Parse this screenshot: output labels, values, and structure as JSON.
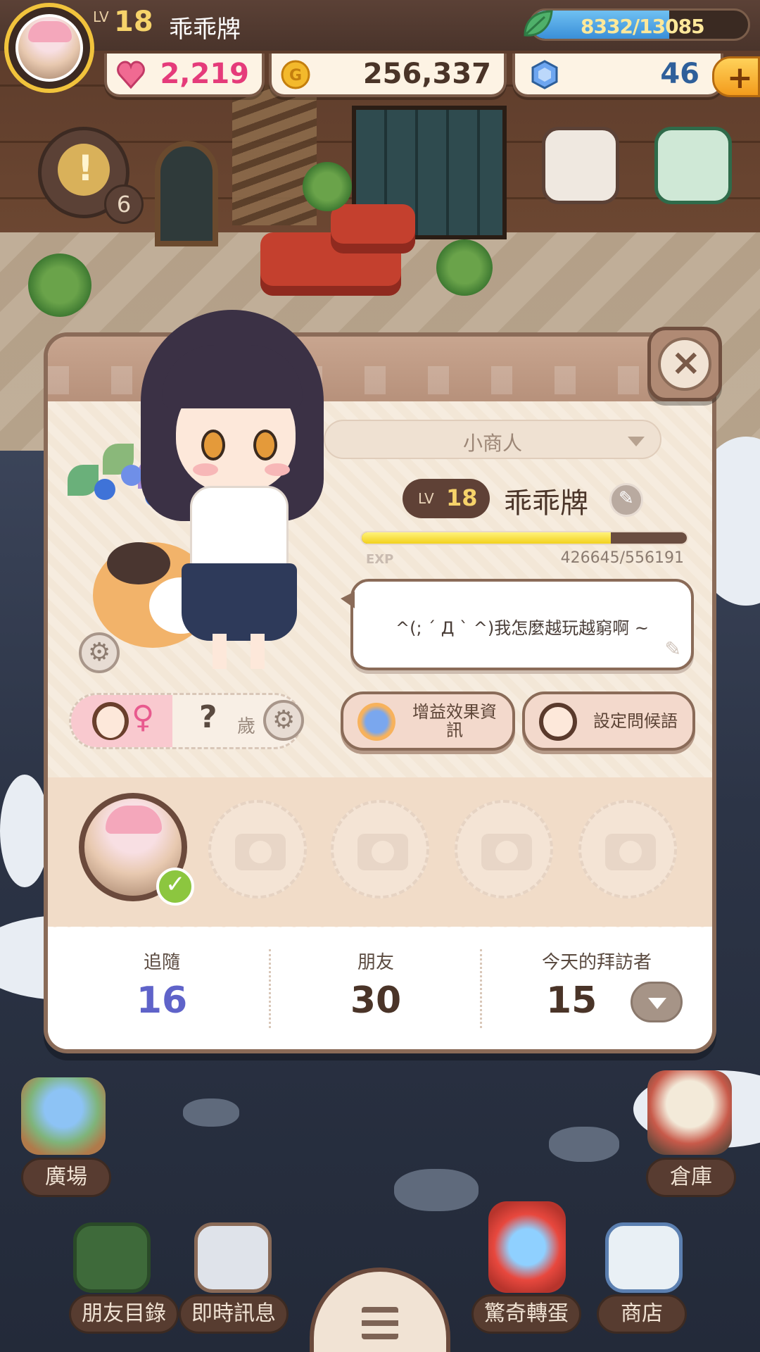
{
  "player": {
    "lv_label": "LV",
    "level": "18",
    "name": "乖乖牌",
    "title": "小商人",
    "exp_label": "EXP",
    "exp_value": "426645/556191",
    "exp_progress": 0.767,
    "greeting": "^(; ´ Д ` ^)我怎麼越玩越窮啊 ~",
    "age_unknown": "?",
    "age_unit": "歲"
  },
  "hud": {
    "energy": "8332/13085",
    "energy_progress": 0.637,
    "hearts": "2,219",
    "coins": "256,337",
    "gems": "46",
    "plus": "+",
    "quest_count": "6",
    "quest_mark": "!"
  },
  "buttons": {
    "buff_info": "增益效果資訊",
    "set_greeting": "設定問候語",
    "close": "×"
  },
  "stats": {
    "following_label": "追隨",
    "following_value": "16",
    "friends_label": "朋友",
    "friends_value": "30",
    "visitors_label": "今天的拜訪者",
    "visitors_value": "15"
  },
  "nav": {
    "plaza": "廣場",
    "warehouse": "倉庫",
    "friends_list": "朋友目錄",
    "messages": "即時訊息",
    "gacha": "驚奇轉蛋",
    "shop": "商店"
  },
  "colors": {
    "following_value": "#5f63c9",
    "stat_value": "#4a3428",
    "hearts": "#e53b7a",
    "coins": "#4a3428",
    "gems": "#2e5f9a"
  }
}
